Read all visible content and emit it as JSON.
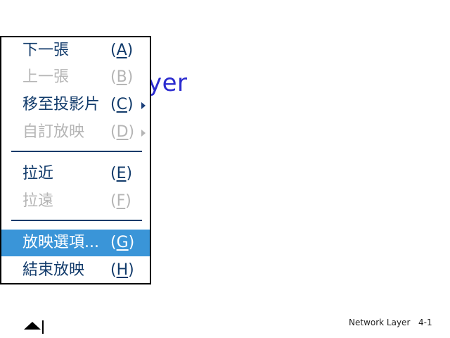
{
  "slide": {
    "title_fragment": "yer"
  },
  "menu": {
    "items": [
      {
        "label": "下一張",
        "key": "A",
        "state": "enabled"
      },
      {
        "label": "上一張",
        "key": "B",
        "state": "disabled"
      },
      {
        "label": "移至投影片",
        "key": "C",
        "state": "enabled",
        "submenu": true
      },
      {
        "label": "自訂放映",
        "key": "D",
        "state": "disabled",
        "submenu": true
      },
      {
        "label": "拉近",
        "key": "E",
        "state": "enabled"
      },
      {
        "label": "拉遠",
        "key": "F",
        "state": "disabled"
      },
      {
        "label": "放映選項...",
        "key": "G",
        "state": "selected"
      },
      {
        "label": "結束放映",
        "key": "H",
        "state": "enabled"
      }
    ]
  },
  "footer": {
    "title": "Network Layer",
    "page": "4-1"
  },
  "icons": {
    "nav_control": "eject-up-triangle-icon"
  },
  "colors": {
    "title_blue": "#2b2bcf",
    "menu_text": "#123b6b",
    "disabled_text": "#b5b5b5",
    "selection_bg": "#3a95d8"
  }
}
